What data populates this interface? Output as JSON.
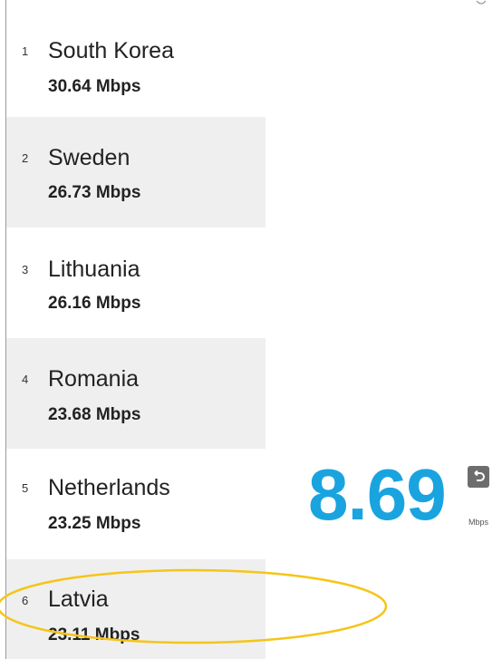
{
  "ranking": [
    {
      "rank": "1",
      "country": "South Korea",
      "speed": "30.64 Mbps"
    },
    {
      "rank": "2",
      "country": "Sweden",
      "speed": "26.73 Mbps"
    },
    {
      "rank": "3",
      "country": "Lithuania",
      "speed": "26.16 Mbps"
    },
    {
      "rank": "4",
      "country": "Romania",
      "speed": "23.68 Mbps"
    },
    {
      "rank": "5",
      "country": "Netherlands",
      "speed": "23.25 Mbps"
    },
    {
      "rank": "6",
      "country": "Latvia",
      "speed": "23.11 Mbps"
    }
  ],
  "speed_widget": {
    "value": "8.69",
    "unit": "Mbps",
    "refresh_icon": "refresh-icon"
  },
  "colors": {
    "accent": "#19a4e0",
    "row_shade": "#efefef",
    "highlight": "#f5c518"
  }
}
